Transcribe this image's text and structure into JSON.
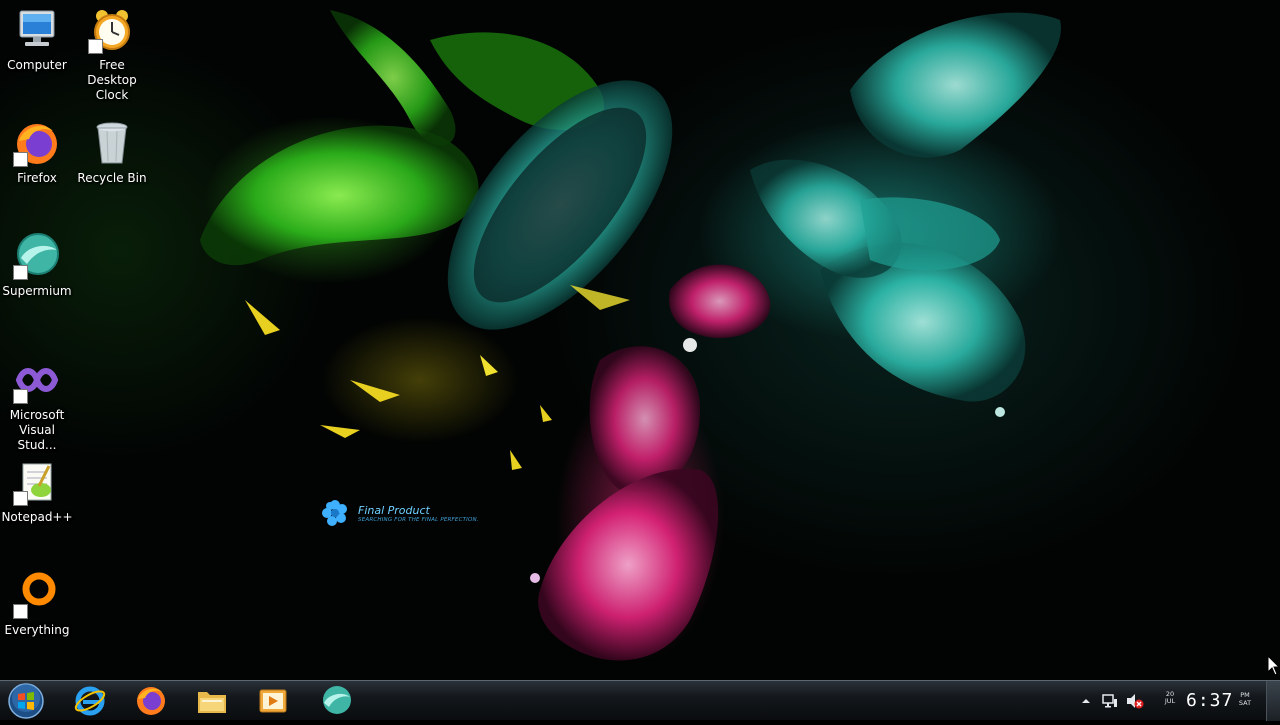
{
  "desktop_icons": [
    {
      "label": "Computer",
      "icon": "computer-icon"
    },
    {
      "label": "Free Desktop Clock",
      "icon": "alarm-clock-icon"
    },
    {
      "label": "Firefox",
      "icon": "firefox-icon"
    },
    {
      "label": "Recycle Bin",
      "icon": "recycle-bin-icon"
    },
    {
      "label": "Supermium",
      "icon": "supermium-icon"
    },
    {
      "label": "Microsoft Visual Stud...",
      "icon": "visual-studio-icon"
    },
    {
      "label": "Notepad++",
      "icon": "notepad-plus-plus-icon"
    },
    {
      "label": "Everything",
      "icon": "everything-search-icon"
    }
  ],
  "wallpaper": {
    "brand_title": "Final Product",
    "brand_subtitle": "SEARCHING FOR THE FINAL PERFECTION."
  },
  "taskbar": {
    "start_icon": "windows-start-orb-icon",
    "pinned": [
      {
        "name": "internet-explorer",
        "icon": "internet-explorer-icon"
      },
      {
        "name": "firefox",
        "icon": "firefox-icon"
      },
      {
        "name": "file-explorer",
        "icon": "folder-icon"
      },
      {
        "name": "media-player",
        "icon": "media-player-icon"
      },
      {
        "name": "supermium",
        "icon": "supermium-icon"
      }
    ],
    "tray": {
      "show_hidden_icon": "chevron-up-icon",
      "network_icon": "network-icon",
      "volume_icon": "volume-muted-icon",
      "clock": {
        "day": "20",
        "month": "JUL",
        "time": "6:37",
        "ampm": "PM",
        "weekday": "SAT"
      }
    }
  }
}
